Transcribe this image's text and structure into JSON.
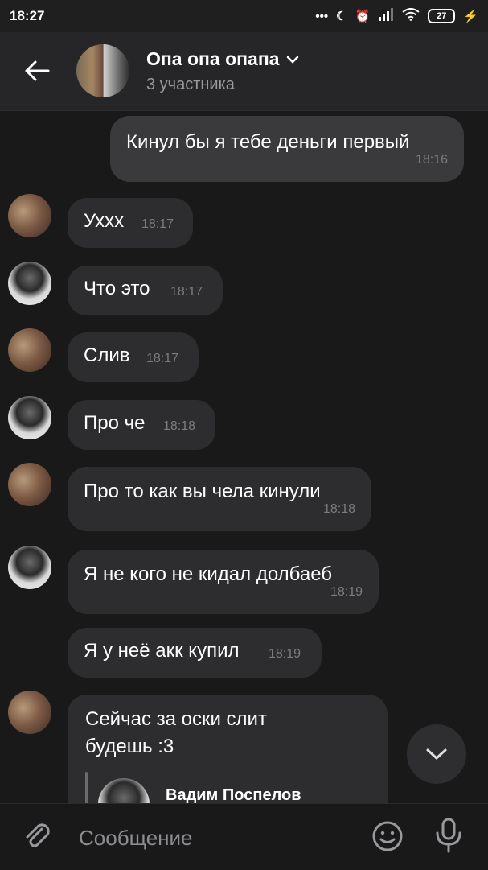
{
  "status_bar": {
    "time": "18:27",
    "dots": "•••",
    "battery": "27"
  },
  "header": {
    "title": "Опа опа опапа",
    "subtitle": "3 участника"
  },
  "messages": [
    {
      "text": "Кинул бы я тебе деньги первый",
      "time": "18:16"
    },
    {
      "text": "Ухxx",
      "time": "18:17"
    },
    {
      "text": "Что это",
      "time": "18:17"
    },
    {
      "text": "Слив",
      "time": "18:17"
    },
    {
      "text": "Про че",
      "time": "18:18"
    },
    {
      "text": "Про то как вы чела кинули",
      "time": "18:18"
    },
    {
      "text": "Я не кого не кидал долбаеб",
      "time": "18:19"
    },
    {
      "text": "Я у неё акк купил",
      "time": "18:19"
    },
    {
      "text_line1": "Сейчас за оски слит",
      "text_line2": "будешь :3",
      "reply_name": "Вадим Поспелов"
    }
  ],
  "composer": {
    "placeholder": "Сообщение"
  },
  "icons": {
    "back": "arrow-left-icon",
    "attach": "paperclip-icon",
    "emoji": "smile-icon",
    "mic": "microphone-icon",
    "scroll": "chevron-down-icon"
  }
}
